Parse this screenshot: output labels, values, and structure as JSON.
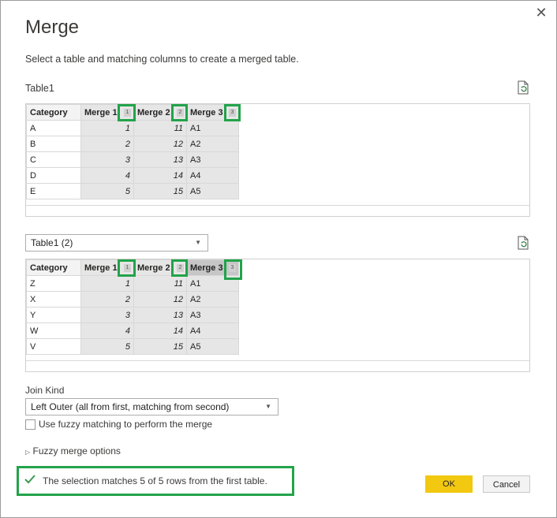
{
  "dialog": {
    "title": "Merge",
    "subtitle": "Select a table and matching columns to create a merged table.",
    "close_icon": "close-icon"
  },
  "table1": {
    "label": "Table1",
    "columns": [
      "Category",
      "Merge 1",
      "Merge 2",
      "Merge 3"
    ],
    "badges": [
      "1",
      "2",
      "3"
    ],
    "rows": [
      [
        "A",
        "1",
        "11",
        "A1"
      ],
      [
        "B",
        "2",
        "12",
        "A2"
      ],
      [
        "C",
        "3",
        "13",
        "A3"
      ],
      [
        "D",
        "4",
        "14",
        "A4"
      ],
      [
        "E",
        "5",
        "15",
        "A5"
      ]
    ]
  },
  "table2": {
    "selected": "Table1 (2)",
    "columns": [
      "Category",
      "Merge 1",
      "Merge 2",
      "Merge 3"
    ],
    "badges": [
      "1",
      "2",
      "3"
    ],
    "rows": [
      [
        "Z",
        "1",
        "11",
        "A1"
      ],
      [
        "X",
        "2",
        "12",
        "A2"
      ],
      [
        "Y",
        "3",
        "13",
        "A3"
      ],
      [
        "W",
        "4",
        "14",
        "A4"
      ],
      [
        "V",
        "5",
        "15",
        "A5"
      ]
    ]
  },
  "join": {
    "label": "Join Kind",
    "selected": "Left Outer (all from first, matching from second)",
    "fuzzy_checkbox_label": "Use fuzzy matching to perform the merge",
    "fuzzy_options_label": "Fuzzy merge options",
    "fuzzy_checked": false
  },
  "status": {
    "text": "The selection matches 5 of 5 rows from the first table.",
    "icon": "checkmark-icon",
    "color": "#22a34a"
  },
  "buttons": {
    "ok": "OK",
    "cancel": "Cancel"
  },
  "colors": {
    "ok_button": "#f2c811",
    "highlight": "#22a34a"
  }
}
